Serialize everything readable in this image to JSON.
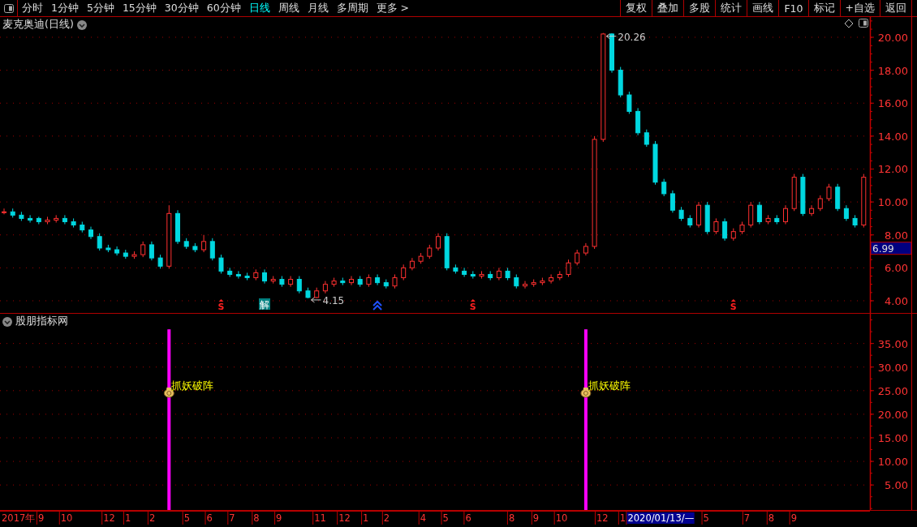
{
  "toolbar": {
    "periods": [
      {
        "label": "分时",
        "selected": false
      },
      {
        "label": "1分钟",
        "selected": false
      },
      {
        "label": "5分钟",
        "selected": false
      },
      {
        "label": "15分钟",
        "selected": false
      },
      {
        "label": "30分钟",
        "selected": false
      },
      {
        "label": "60分钟",
        "selected": false
      },
      {
        "label": "日线",
        "selected": true
      },
      {
        "label": "周线",
        "selected": false
      },
      {
        "label": "月线",
        "selected": false
      },
      {
        "label": "多周期",
        "selected": false
      },
      {
        "label": "更多 >",
        "selected": false
      }
    ],
    "buttons": [
      "复权",
      "叠加",
      "多股",
      "统计",
      "画线",
      "F10",
      "标记",
      "+自选",
      "返回"
    ]
  },
  "price_panel": {
    "title": "麦克奥迪(日线)",
    "current_price": "6.99",
    "chart_data": {
      "type": "candlestick",
      "grid": true,
      "ylim": [
        3.26,
        21.23
      ],
      "yticks": [
        {
          "value": 4,
          "label": "4.00"
        },
        {
          "value": 6,
          "label": "6.00"
        },
        {
          "value": 8,
          "label": "8.00"
        },
        {
          "value": 10,
          "label": "10.00"
        },
        {
          "value": 12,
          "label": "12.00"
        },
        {
          "value": 14,
          "label": "14.00"
        },
        {
          "value": 16,
          "label": "16.00"
        },
        {
          "value": 18,
          "label": "18.00"
        },
        {
          "value": 20,
          "label": "20.00"
        }
      ],
      "ohlc": [
        [
          9.4,
          9.6,
          9.25,
          9.4
        ],
        [
          9.4,
          9.6,
          9.05,
          9.2
        ],
        [
          9.2,
          9.4,
          8.85,
          9.0
        ],
        [
          9.0,
          9.2,
          8.75,
          8.9
        ],
        [
          9.0,
          9.1,
          8.65,
          8.8
        ],
        [
          8.8,
          9.1,
          8.65,
          8.9
        ],
        [
          8.9,
          9.2,
          8.75,
          9.0
        ],
        [
          9.0,
          9.2,
          8.65,
          8.8
        ],
        [
          8.8,
          9.0,
          8.45,
          8.6
        ],
        [
          8.6,
          8.8,
          8.15,
          8.3
        ],
        [
          8.3,
          8.5,
          7.75,
          7.9
        ],
        [
          7.9,
          8.1,
          7.05,
          7.2
        ],
        [
          7.2,
          7.4,
          6.95,
          7.1
        ],
        [
          7.1,
          7.3,
          6.75,
          6.9
        ],
        [
          6.9,
          7.1,
          6.55,
          6.7
        ],
        [
          6.7,
          7.0,
          6.55,
          6.8
        ],
        [
          6.8,
          7.6,
          6.65,
          7.4
        ],
        [
          7.4,
          7.6,
          6.45,
          6.6
        ],
        [
          6.6,
          6.8,
          5.95,
          6.1
        ],
        [
          6.1,
          9.8,
          5.95,
          9.3
        ],
        [
          9.3,
          9.5,
          7.45,
          7.6
        ],
        [
          7.6,
          7.8,
          7.15,
          7.3
        ],
        [
          7.3,
          7.5,
          6.95,
          7.1
        ],
        [
          7.1,
          8.0,
          6.95,
          7.6
        ],
        [
          7.6,
          7.8,
          6.45,
          6.6
        ],
        [
          6.6,
          6.8,
          5.65,
          5.8
        ],
        [
          5.8,
          6.0,
          5.45,
          5.6
        ],
        [
          5.6,
          5.8,
          5.35,
          5.5
        ],
        [
          5.5,
          5.7,
          5.25,
          5.4
        ],
        [
          5.4,
          5.9,
          5.25,
          5.7
        ],
        [
          5.7,
          5.9,
          5.05,
          5.2
        ],
        [
          5.2,
          5.5,
          5.05,
          5.3
        ],
        [
          5.3,
          5.5,
          4.85,
          5.0
        ],
        [
          5.0,
          5.5,
          4.85,
          5.3
        ],
        [
          5.3,
          5.5,
          4.45,
          4.6
        ],
        [
          4.6,
          4.8,
          4.15,
          4.2
        ],
        [
          4.2,
          4.8,
          4.16,
          4.6
        ],
        [
          4.6,
          5.2,
          4.45,
          5.0
        ],
        [
          5.0,
          5.4,
          4.85,
          5.2
        ],
        [
          5.2,
          5.4,
          4.95,
          5.1
        ],
        [
          5.1,
          5.5,
          4.95,
          5.3
        ],
        [
          5.3,
          5.5,
          4.85,
          5.0
        ],
        [
          5.0,
          5.6,
          4.85,
          5.4
        ],
        [
          5.4,
          5.6,
          4.95,
          5.1
        ],
        [
          5.1,
          5.3,
          4.75,
          4.9
        ],
        [
          4.9,
          5.6,
          4.75,
          5.4
        ],
        [
          5.4,
          6.2,
          5.25,
          6.0
        ],
        [
          6.0,
          6.6,
          5.85,
          6.4
        ],
        [
          6.4,
          6.9,
          6.25,
          6.7
        ],
        [
          6.7,
          7.4,
          6.55,
          7.2
        ],
        [
          7.2,
          8.1,
          7.05,
          7.9
        ],
        [
          7.9,
          8.1,
          5.85,
          6.0
        ],
        [
          6.0,
          6.2,
          5.65,
          5.8
        ],
        [
          5.8,
          6.0,
          5.45,
          5.6
        ],
        [
          5.6,
          5.8,
          5.35,
          5.5
        ],
        [
          5.5,
          5.8,
          5.35,
          5.6
        ],
        [
          5.6,
          5.8,
          5.25,
          5.4
        ],
        [
          5.4,
          6.0,
          5.25,
          5.8
        ],
        [
          5.8,
          6.0,
          5.25,
          5.4
        ],
        [
          5.4,
          5.6,
          4.75,
          4.9
        ],
        [
          4.9,
          5.2,
          4.75,
          5.0
        ],
        [
          5.0,
          5.3,
          4.85,
          5.1
        ],
        [
          5.1,
          5.4,
          4.95,
          5.2
        ],
        [
          5.2,
          5.6,
          5.05,
          5.4
        ],
        [
          5.4,
          5.8,
          5.25,
          5.6
        ],
        [
          5.6,
          6.5,
          5.45,
          6.3
        ],
        [
          6.3,
          7.1,
          6.15,
          6.9
        ],
        [
          6.9,
          7.5,
          6.75,
          7.3
        ],
        [
          7.3,
          14.0,
          7.15,
          13.8
        ],
        [
          13.8,
          20.26,
          13.65,
          20.2
        ],
        [
          20.2,
          20.25,
          17.85,
          18.0
        ],
        [
          18.0,
          18.2,
          16.35,
          16.5
        ],
        [
          16.5,
          16.7,
          15.35,
          15.5
        ],
        [
          15.5,
          15.7,
          14.05,
          14.2
        ],
        [
          14.2,
          14.4,
          13.35,
          13.5
        ],
        [
          13.5,
          13.7,
          11.05,
          11.2
        ],
        [
          11.2,
          11.4,
          10.35,
          10.5
        ],
        [
          10.5,
          10.7,
          9.35,
          9.5
        ],
        [
          9.5,
          9.7,
          8.85,
          9.0
        ],
        [
          9.0,
          9.2,
          8.45,
          8.6
        ],
        [
          8.6,
          10.0,
          8.45,
          9.8
        ],
        [
          9.8,
          10.0,
          8.05,
          8.2
        ],
        [
          8.2,
          9.0,
          8.05,
          8.8
        ],
        [
          8.8,
          9.0,
          7.65,
          7.8
        ],
        [
          7.8,
          8.4,
          7.65,
          8.2
        ],
        [
          8.2,
          8.8,
          8.05,
          8.6
        ],
        [
          8.6,
          10.0,
          8.45,
          9.8
        ],
        [
          9.8,
          10.0,
          8.65,
          8.8
        ],
        [
          8.8,
          9.2,
          8.65,
          9.0
        ],
        [
          9.0,
          9.2,
          8.65,
          8.8
        ],
        [
          8.8,
          9.8,
          8.65,
          9.6
        ],
        [
          9.6,
          11.7,
          9.45,
          11.5
        ],
        [
          11.5,
          11.7,
          9.15,
          9.3
        ],
        [
          9.3,
          9.8,
          9.15,
          9.6
        ],
        [
          9.6,
          10.4,
          9.45,
          10.2
        ],
        [
          10.2,
          11.1,
          10.05,
          10.9
        ],
        [
          10.9,
          11.1,
          9.45,
          9.6
        ],
        [
          9.6,
          9.8,
          8.85,
          9.0
        ],
        [
          9.0,
          9.2,
          8.45,
          8.6
        ],
        [
          8.6,
          11.7,
          8.45,
          11.5
        ]
      ],
      "annotations": [
        {
          "text": "20.26"
        },
        {
          "text": "4.15"
        }
      ]
    },
    "signals": [
      {
        "kind": "buy",
        "text": "S"
      },
      {
        "kind": "tag",
        "text": "解"
      },
      {
        "kind": "arrow"
      },
      {
        "kind": "buy",
        "text": "S"
      },
      {
        "kind": "buy",
        "text": "S"
      }
    ]
  },
  "indicator_panel": {
    "title": "股朋指标网",
    "chart_data": {
      "type": "bar",
      "grid": true,
      "ylim": [
        -0.3,
        41.3
      ],
      "yticks": [
        {
          "value": 5,
          "label": "5.00"
        },
        {
          "value": 10,
          "label": "10.00"
        },
        {
          "value": 15,
          "label": "15.00"
        },
        {
          "value": 20,
          "label": "20.00"
        },
        {
          "value": 25,
          "label": "25.00"
        },
        {
          "value": 30,
          "label": "30.00"
        },
        {
          "value": 35,
          "label": "35.00"
        }
      ],
      "values": [
        null,
        null,
        null,
        null,
        null,
        null,
        null,
        null,
        null,
        null,
        null,
        null,
        null,
        null,
        null,
        null,
        null,
        null,
        null,
        38,
        null,
        null,
        null,
        null,
        null,
        null,
        null,
        null,
        null,
        null,
        null,
        null,
        null,
        null,
        null,
        null,
        null,
        null,
        null,
        null,
        null,
        null,
        null,
        null,
        null,
        null,
        null,
        null,
        null,
        null,
        null,
        null,
        null,
        null,
        null,
        null,
        null,
        null,
        null,
        null,
        null,
        null,
        null,
        null,
        null,
        null,
        null,
        38,
        null,
        null,
        null,
        null,
        null,
        null,
        null,
        null,
        null,
        null,
        null,
        null,
        null,
        null,
        null,
        null,
        null,
        null,
        null,
        null,
        null,
        null,
        null,
        null,
        null,
        null,
        null,
        null,
        null,
        null,
        null,
        null
      ],
      "annotations": [
        {
          "text": "抓妖破阵"
        },
        {
          "text": "抓妖破阵"
        }
      ]
    }
  },
  "date_axis": [
    {
      "label": "2017年",
      "selected": false
    },
    {
      "label": "9",
      "selected": false
    },
    {
      "label": "10",
      "selected": false
    },
    {
      "label": "12",
      "selected": false
    },
    {
      "label": "1",
      "selected": false
    },
    {
      "label": "2",
      "selected": false
    },
    {
      "label": "5",
      "selected": false
    },
    {
      "label": "6",
      "selected": false
    },
    {
      "label": "7",
      "selected": false
    },
    {
      "label": "8",
      "selected": false
    },
    {
      "label": "9",
      "selected": false
    },
    {
      "label": "11",
      "selected": false
    },
    {
      "label": "12",
      "selected": false
    },
    {
      "label": "1",
      "selected": false
    },
    {
      "label": "2",
      "selected": false
    },
    {
      "label": "4",
      "selected": false
    },
    {
      "label": "5",
      "selected": false
    },
    {
      "label": "6",
      "selected": false
    },
    {
      "label": "8",
      "selected": false
    },
    {
      "label": "9",
      "selected": false
    },
    {
      "label": "10",
      "selected": false
    },
    {
      "label": "12",
      "selected": false
    },
    {
      "label": "1",
      "selected": false
    },
    {
      "label": "2020/01/13/—",
      "selected": true
    },
    {
      "label": "5",
      "selected": false
    },
    {
      "label": "7",
      "selected": false
    },
    {
      "label": "8",
      "selected": false
    },
    {
      "label": "9",
      "selected": false
    }
  ]
}
